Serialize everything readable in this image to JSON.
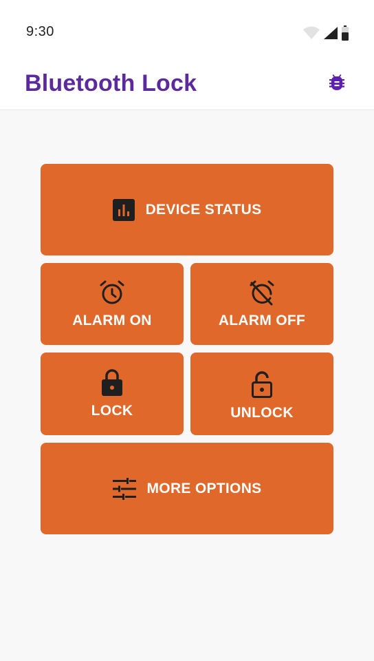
{
  "status_bar": {
    "time": "9:30",
    "icons": [
      "wifi-icon",
      "signal-icon",
      "battery-icon"
    ]
  },
  "app_bar": {
    "title": "Bluetooth Lock",
    "title_color": "#5b2a9c",
    "action_icon": "bug-icon"
  },
  "tiles": {
    "device_status": {
      "label": "DEVICE STATUS",
      "icon": "bar-chart-icon"
    },
    "alarm_on": {
      "label": "ALARM ON",
      "icon": "alarm-icon"
    },
    "alarm_off": {
      "label": "ALARM OFF",
      "icon": "alarm-off-icon"
    },
    "lock": {
      "label": "LOCK",
      "icon": "lock-icon"
    },
    "unlock": {
      "label": "UNLOCK",
      "icon": "lock-open-icon"
    },
    "more_options": {
      "label": "MORE OPTIONS",
      "icon": "tune-icon"
    }
  },
  "colors": {
    "tile_background": "#e0682a",
    "tile_text": "#ffffff",
    "icon": "#1f1f1f",
    "background": "#f8f8f8"
  }
}
